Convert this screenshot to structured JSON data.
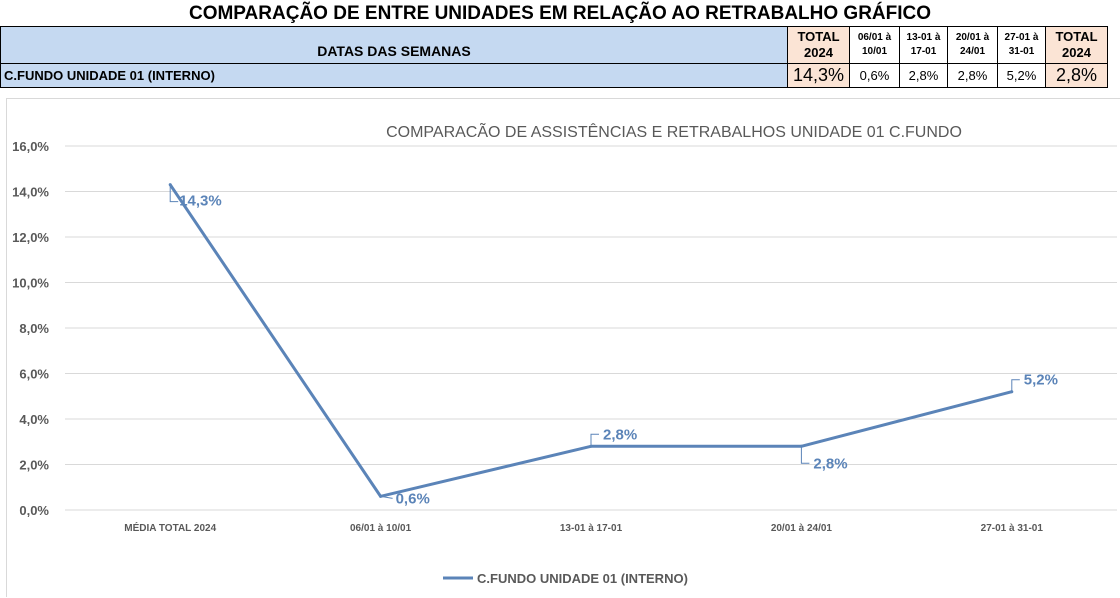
{
  "page_title": "COMPARAÇÃO DE ENTRE UNIDADES EM RELAÇÃO AO RETRABALHO GRÁFICO",
  "table": {
    "header_label": "DATAS DAS SEMANAS",
    "col_total_1": [
      "TOTAL",
      "2024"
    ],
    "week_cols": [
      [
        "06/01 à",
        "10/01"
      ],
      [
        "13-01 à",
        "17-01"
      ],
      [
        "20/01 à",
        "24/01"
      ],
      [
        "27-01 à",
        "31-01"
      ]
    ],
    "col_total_2": [
      "TOTAL",
      "2024"
    ],
    "row_label": "C.FUNDO UNIDADE 01 (INTERNO)",
    "row_total_1": "14,3%",
    "row_weeks": [
      "0,6%",
      "2,8%",
      "2,8%",
      "5,2%"
    ],
    "row_total_2": "2,8%"
  },
  "colors": {
    "header_blue": "#c5d9f1",
    "total_peach": "#fbe4d5",
    "series_line": "#5b84b8",
    "label_blue": "#5b84b8"
  },
  "chart_data": {
    "type": "line",
    "title": "COMPARACÃO DE ASSISTÊNCIAS E RETRABALHOS UNIDADE 01 C.FUNDO",
    "categories": [
      "MÉDIA TOTAL 2024",
      "06/01 à 10/01",
      "13-01 à 17-01",
      "20/01 à 24/01",
      "27-01 à 31-01"
    ],
    "series": [
      {
        "name": "C.FUNDO UNIDADE 01 (INTERNO)",
        "values": [
          14.3,
          0.6,
          2.8,
          2.8,
          5.2
        ],
        "labels": [
          "14,3%",
          "0,6%",
          "2,8%",
          "2,8%",
          "5,2%"
        ]
      }
    ],
    "yticks": [
      "0,0%",
      "2,0%",
      "4,0%",
      "6,0%",
      "8,0%",
      "10,0%",
      "12,0%",
      "14,0%",
      "16,0%"
    ],
    "ylim": [
      0,
      16
    ],
    "grid": true,
    "legend": "bottom"
  }
}
